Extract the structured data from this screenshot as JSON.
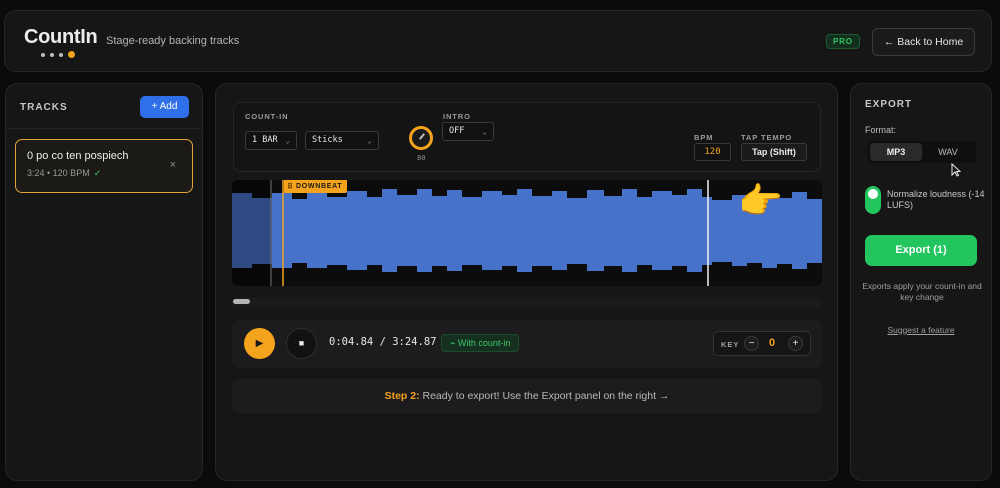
{
  "header": {
    "logo": "CountIn",
    "tagline": "Stage-ready backing tracks",
    "pro_badge": "PRO",
    "home_button": "← Back to Home"
  },
  "tracks": {
    "title": "TRACKS",
    "add_button": "+ Add",
    "items": [
      {
        "name": "0 po co ten pospiech",
        "meta": "3:24 • 120 BPM",
        "status_icon": "✓",
        "remove_icon": "×"
      }
    ]
  },
  "controls": {
    "count_in_label": "COUNT-IN",
    "bars_value": "1 BAR",
    "sound_value": "Sticks",
    "volume_value": "80",
    "intro_label": "INTRO",
    "intro_value": "OFF",
    "bpm_label": "BPM",
    "bpm_value": "120",
    "tap_label": "TAP TEMPO",
    "tap_button": "Tap (Shift)"
  },
  "waveform": {
    "downbeat_label": "DOWNBEAT",
    "hand_icon": "👉",
    "color": "#4a78d4",
    "accent": "#f4a31c"
  },
  "transport": {
    "play_icon": "▶",
    "stop_icon": "■",
    "time": "0:04.84 / 3:24.87",
    "count_in_badge": "⌁ With count-in",
    "key_label": "KEY",
    "key_minus": "−",
    "key_value": "0",
    "key_plus": "+"
  },
  "step": {
    "prefix": "Step 2:",
    "text": " Ready to export! Use the Export panel on the right →"
  },
  "export": {
    "title": "EXPORT",
    "format_label": "Format:",
    "formats": [
      "MP3",
      "WAV"
    ],
    "selected_format": "MP3",
    "normalize_label": "Normalize loudness (-14 LUFS)",
    "normalize_on": true,
    "export_button": "Export (1)",
    "note": "Exports apply your count-in and key change",
    "suggest_link": "Suggest a feature"
  }
}
